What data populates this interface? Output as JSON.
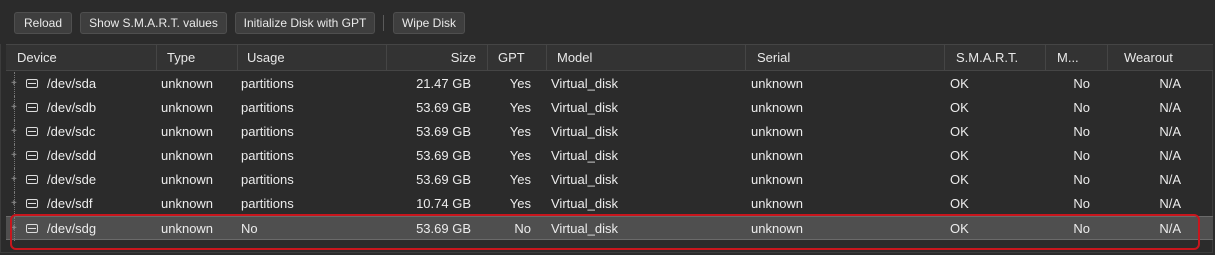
{
  "toolbar": {
    "reload": "Reload",
    "smart": "Show S.M.A.R.T. values",
    "init_gpt": "Initialize Disk with GPT",
    "wipe": "Wipe Disk"
  },
  "columns": {
    "device": "Device",
    "type": "Type",
    "usage": "Usage",
    "size": "Size",
    "gpt": "GPT",
    "model": "Model",
    "serial": "Serial",
    "smart": "S.M.A.R.T.",
    "mounted": "M...",
    "wearout": "Wearout"
  },
  "rows": [
    {
      "device": "/dev/sda",
      "type": "unknown",
      "usage": "partitions",
      "size": "21.47 GB",
      "gpt": "Yes",
      "model": "Virtual_disk",
      "serial": "unknown",
      "smart": "OK",
      "mounted": "No",
      "wearout": "N/A"
    },
    {
      "device": "/dev/sdb",
      "type": "unknown",
      "usage": "partitions",
      "size": "53.69 GB",
      "gpt": "Yes",
      "model": "Virtual_disk",
      "serial": "unknown",
      "smart": "OK",
      "mounted": "No",
      "wearout": "N/A"
    },
    {
      "device": "/dev/sdc",
      "type": "unknown",
      "usage": "partitions",
      "size": "53.69 GB",
      "gpt": "Yes",
      "model": "Virtual_disk",
      "serial": "unknown",
      "smart": "OK",
      "mounted": "No",
      "wearout": "N/A"
    },
    {
      "device": "/dev/sdd",
      "type": "unknown",
      "usage": "partitions",
      "size": "53.69 GB",
      "gpt": "Yes",
      "model": "Virtual_disk",
      "serial": "unknown",
      "smart": "OK",
      "mounted": "No",
      "wearout": "N/A"
    },
    {
      "device": "/dev/sde",
      "type": "unknown",
      "usage": "partitions",
      "size": "53.69 GB",
      "gpt": "Yes",
      "model": "Virtual_disk",
      "serial": "unknown",
      "smart": "OK",
      "mounted": "No",
      "wearout": "N/A"
    },
    {
      "device": "/dev/sdf",
      "type": "unknown",
      "usage": "partitions",
      "size": "10.74 GB",
      "gpt": "Yes",
      "model": "Virtual_disk",
      "serial": "unknown",
      "smart": "OK",
      "mounted": "No",
      "wearout": "N/A"
    },
    {
      "device": "/dev/sdg",
      "type": "unknown",
      "usage": "No",
      "size": "53.69 GB",
      "gpt": "No",
      "model": "Virtual_disk",
      "serial": "unknown",
      "smart": "OK",
      "mounted": "No",
      "wearout": "N/A"
    }
  ],
  "selected_row_index": 6,
  "icons": {
    "row_icon": "hard-drive-icon",
    "expander": "tree-expand-icon"
  },
  "colors": {
    "highlight": "#c8161d",
    "selected_row": "#4f4f4f",
    "background": "#2b2b2b"
  }
}
